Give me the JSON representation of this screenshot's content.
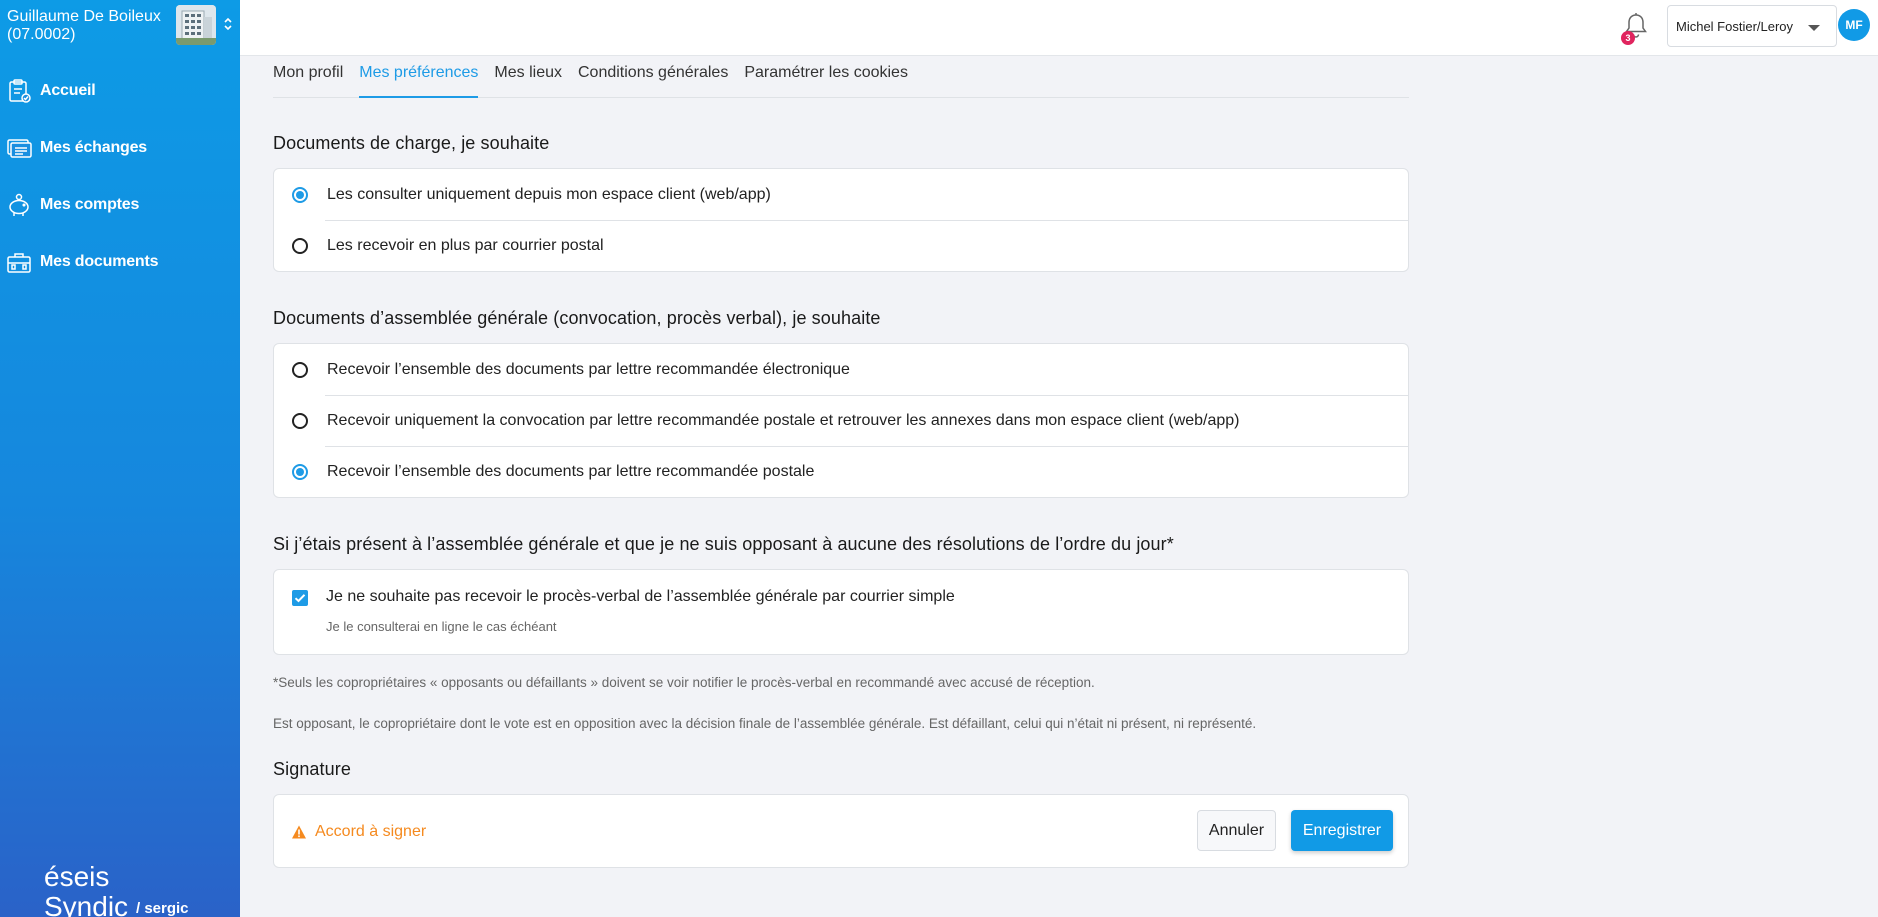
{
  "sidebar": {
    "owner_name": "Guillaume De Boileux",
    "owner_code": "(07.0002)",
    "items": [
      {
        "label": "Accueil",
        "icon": "clipboard-icon"
      },
      {
        "label": "Mes échanges",
        "icon": "messages-icon"
      },
      {
        "label": "Mes comptes",
        "icon": "piggy-bank-icon"
      },
      {
        "label": "Mes documents",
        "icon": "briefcase-icon"
      }
    ],
    "brand_name": "éseis Syndic",
    "brand_sub": "/ sergic"
  },
  "topbar": {
    "notification_count": "3",
    "user_select_value": "Michel Fostier/Leroy",
    "avatar_initials": "MF"
  },
  "tabs": [
    {
      "label": "Mon profil",
      "active": false
    },
    {
      "label": "Mes préférences",
      "active": true
    },
    {
      "label": "Mes lieux",
      "active": false
    },
    {
      "label": "Conditions générales",
      "active": false
    },
    {
      "label": "Paramétrer les cookies",
      "active": false
    }
  ],
  "charge_docs": {
    "title": "Documents de charge, je souhaite",
    "options": [
      {
        "label": "Les consulter uniquement depuis mon espace client (web/app)",
        "selected": true
      },
      {
        "label": "Les recevoir en plus par courrier postal",
        "selected": false
      }
    ]
  },
  "ag_docs": {
    "title": "Documents d’assemblée générale (convocation, procès verbal), je souhaite",
    "options": [
      {
        "label": "Recevoir l’ensemble des documents par lettre recommandée électronique",
        "selected": false
      },
      {
        "label": "Recevoir uniquement la convocation par lettre recommandée postale et retrouver les annexes dans mon espace client (web/app)",
        "selected": false
      },
      {
        "label": "Recevoir l’ensemble des documents par lettre recommandée postale",
        "selected": true
      }
    ]
  },
  "pv": {
    "title": "Si j’étais présent à l’assemblée générale et que je ne suis opposant à aucune des résolutions de l’ordre du jour*",
    "checkbox_label": "Je ne souhaite pas recevoir le procès-verbal de l’assemblée générale par courrier simple",
    "checkbox_sub": "Je le consulterai en ligne le cas échéant",
    "checked": true
  },
  "notes": {
    "note1": "*Seuls les copropriétaires « opposants ou défaillants » doivent se voir notifier le procès-verbal en recommandé avec accusé de réception.",
    "note2": "Est opposant, le copropriétaire dont le vote est en opposition avec la décision finale de l’assemblée générale. Est défaillant, celui qui n’était ni présent, ni représenté."
  },
  "signature": {
    "title": "Signature",
    "warning": "Accord à signer",
    "cancel_label": "Annuler",
    "save_label": "Enregistrer"
  },
  "colors": {
    "accent": "#119ae6",
    "warning": "#f58a1f",
    "badge": "#e0245e"
  }
}
